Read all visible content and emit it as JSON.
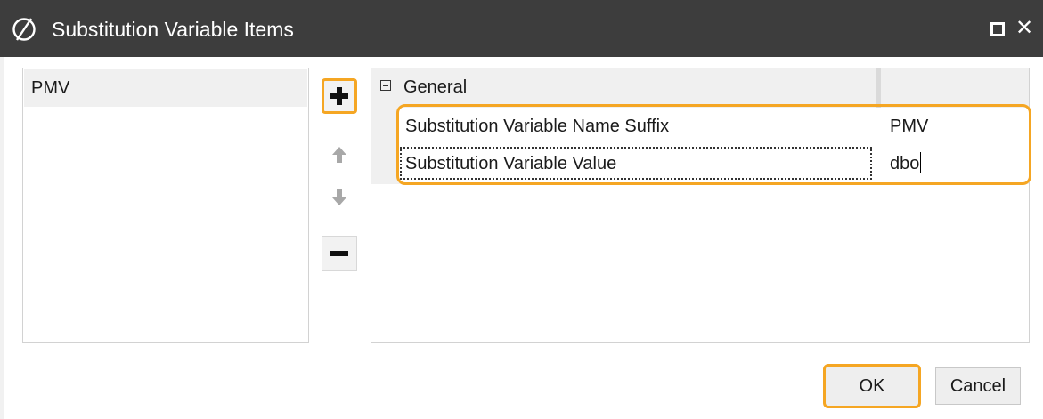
{
  "window": {
    "title": "Substitution Variable Items",
    "logo_icon": "substitution-logo-icon",
    "maximize_icon": "maximize-icon",
    "close_icon": "close-icon",
    "titlebar_color": "#3d3d3d"
  },
  "list": {
    "items": [
      {
        "label": "PMV",
        "selected": true
      }
    ]
  },
  "side_buttons": {
    "add_icon": "plus-icon",
    "move_up_icon": "arrow-up-icon",
    "move_down_icon": "arrow-down-icon",
    "remove_icon": "minus-icon"
  },
  "properties": {
    "group_label": "General",
    "group_toggle_icon": "collapse-icon",
    "rows": [
      {
        "name": "Substitution Variable Name Suffix",
        "value": "PMV"
      },
      {
        "name": "Substitution Variable Value",
        "value": "dbo"
      }
    ]
  },
  "footer": {
    "ok_label": "OK",
    "cancel_label": "Cancel"
  },
  "highlight_color": "#f5a623"
}
